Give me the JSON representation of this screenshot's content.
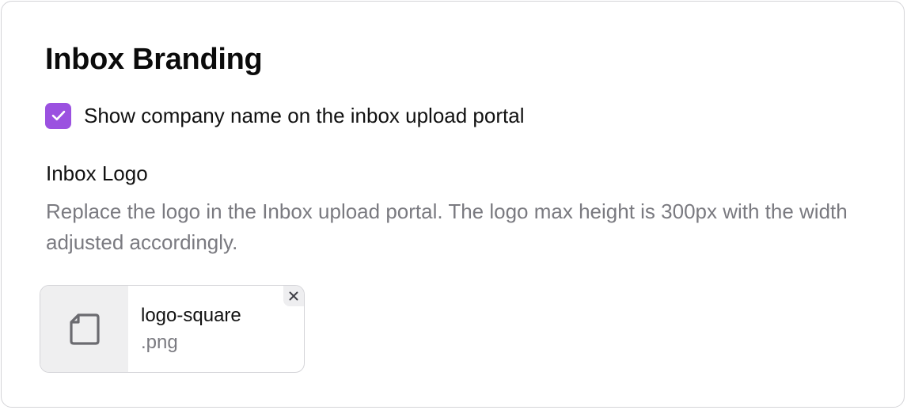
{
  "branding": {
    "title": "Inbox Branding",
    "show_company_name": {
      "label": "Show company name on the inbox upload portal",
      "checked": true,
      "accent_color": "#9b51e0"
    }
  },
  "logo_section": {
    "title": "Inbox Logo",
    "description": "Replace the logo in the Inbox upload portal. The logo max height is 300px with the width adjusted accordingly.",
    "file": {
      "name": "logo-square",
      "extension": ".png",
      "icon": "file-icon",
      "remove_icon": "close-icon"
    }
  }
}
